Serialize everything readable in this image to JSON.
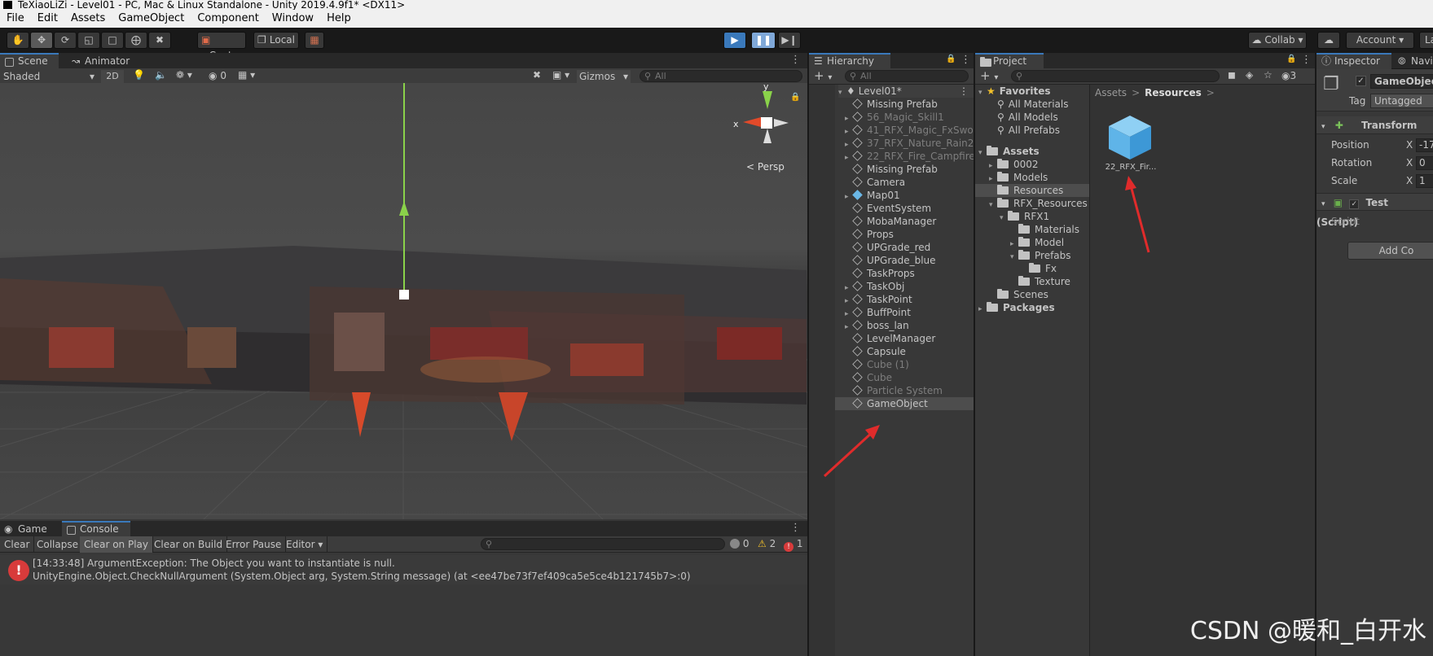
{
  "window": {
    "title": "TeXiaoLiZi - Level01 - PC, Mac & Linux Standalone - Unity 2019.4.9f1* <DX11>"
  },
  "menu": [
    "File",
    "Edit",
    "Assets",
    "GameObject",
    "Component",
    "Window",
    "Help"
  ],
  "toolbar": {
    "center_label": "Center",
    "local_label": "Local",
    "collab_label": "Collab",
    "account_label": "Account",
    "layers_label": "La"
  },
  "scene_panel": {
    "tabs": [
      "Scene",
      "Animator"
    ],
    "shading": "Shaded",
    "mode_2d": "2D",
    "hidden_count": "0",
    "gizmos_label": "Gizmos",
    "search_placeholder": "All",
    "persp_label": "Persp",
    "axis_x": "x",
    "axis_y": "y"
  },
  "hierarchy": {
    "tab": "Hierarchy",
    "search_placeholder": "All",
    "scene_name": "Level01*",
    "items": [
      {
        "label": "Missing Prefab",
        "style": "normal",
        "expand": false
      },
      {
        "label": "56_Magic_Skill1",
        "style": "dim",
        "expand": true
      },
      {
        "label": "41_RFX_Magic_FxSwo",
        "style": "dim",
        "expand": true
      },
      {
        "label": "37_RFX_Nature_Rain2",
        "style": "dim",
        "expand": true
      },
      {
        "label": "22_RFX_Fire_Campfire",
        "style": "dim",
        "expand": true
      },
      {
        "label": "Missing Prefab",
        "style": "normal",
        "expand": false
      },
      {
        "label": "Camera",
        "style": "normal",
        "expand": false
      },
      {
        "label": "Map01",
        "style": "normal",
        "expand": true
      },
      {
        "label": "EventSystem",
        "style": "normal",
        "expand": false
      },
      {
        "label": "MobaManager",
        "style": "normal",
        "expand": false
      },
      {
        "label": "Props",
        "style": "normal",
        "expand": false
      },
      {
        "label": "UPGrade_red",
        "style": "normal",
        "expand": false
      },
      {
        "label": "UPGrade_blue",
        "style": "normal",
        "expand": false
      },
      {
        "label": "TaskProps",
        "style": "normal",
        "expand": false
      },
      {
        "label": "TaskObj",
        "style": "normal",
        "expand": true
      },
      {
        "label": "TaskPoint",
        "style": "normal",
        "expand": true
      },
      {
        "label": "BuffPoint",
        "style": "normal",
        "expand": true
      },
      {
        "label": "boss_lan",
        "style": "normal",
        "expand": true
      },
      {
        "label": "LevelManager",
        "style": "normal",
        "expand": false
      },
      {
        "label": "Capsule",
        "style": "normal",
        "expand": false
      },
      {
        "label": "Cube (1)",
        "style": "dim",
        "expand": false
      },
      {
        "label": "Cube",
        "style": "dim",
        "expand": false
      },
      {
        "label": "Particle System",
        "style": "dim",
        "expand": false
      },
      {
        "label": "GameObject",
        "style": "selected",
        "expand": false
      }
    ]
  },
  "project": {
    "tab": "Project",
    "breadcrumb": [
      "Assets",
      "Resources"
    ],
    "hidden_count": "3",
    "tree": [
      {
        "label": "Favorites",
        "indent": 0,
        "kind": "star",
        "arrow": "open"
      },
      {
        "label": "All Materials",
        "indent": 1,
        "kind": "search",
        "arrow": ""
      },
      {
        "label": "All Models",
        "indent": 1,
        "kind": "search",
        "arrow": ""
      },
      {
        "label": "All Prefabs",
        "indent": 1,
        "kind": "search",
        "arrow": ""
      },
      {
        "label": "",
        "indent": 0,
        "kind": "gap",
        "arrow": ""
      },
      {
        "label": "Assets",
        "indent": 0,
        "kind": "folder",
        "arrow": "open"
      },
      {
        "label": "0002",
        "indent": 1,
        "kind": "folder",
        "arrow": "closed"
      },
      {
        "label": "Models",
        "indent": 1,
        "kind": "folder",
        "arrow": "closed"
      },
      {
        "label": "Resources",
        "indent": 1,
        "kind": "folder",
        "arrow": "",
        "selected": true
      },
      {
        "label": "RFX_Resources",
        "indent": 1,
        "kind": "folder",
        "arrow": "open"
      },
      {
        "label": "RFX1",
        "indent": 2,
        "kind": "folder",
        "arrow": "open"
      },
      {
        "label": "Materials",
        "indent": 3,
        "kind": "folder",
        "arrow": ""
      },
      {
        "label": "Model",
        "indent": 3,
        "kind": "folder",
        "arrow": "closed"
      },
      {
        "label": "Prefabs",
        "indent": 3,
        "kind": "folder",
        "arrow": "open"
      },
      {
        "label": "Fx",
        "indent": 4,
        "kind": "folder",
        "arrow": ""
      },
      {
        "label": "Texture",
        "indent": 3,
        "kind": "folder",
        "arrow": ""
      },
      {
        "label": "Scenes",
        "indent": 1,
        "kind": "folder",
        "arrow": ""
      },
      {
        "label": "Packages",
        "indent": 0,
        "kind": "folder",
        "arrow": "closed"
      }
    ],
    "asset": {
      "label": "22_RFX_Fir..."
    }
  },
  "inspector": {
    "tabs": [
      "Inspector",
      "Navi"
    ],
    "object_name": "GameObject",
    "tag_label": "Tag",
    "tag_value": "Untagged",
    "transform_label": "Transform",
    "fields": [
      {
        "label": "Position",
        "axis": "X",
        "value": "-17"
      },
      {
        "label": "Rotation",
        "axis": "X",
        "value": "0"
      },
      {
        "label": "Scale",
        "axis": "X",
        "value": "1"
      }
    ],
    "script_component": "Test (Script)",
    "script_label": "Script",
    "add_component": "Add Co"
  },
  "console": {
    "tabs": [
      "Game",
      "Console"
    ],
    "buttons": [
      "Clear",
      "Collapse",
      "Clear on Play",
      "Clear on Build",
      "Error Pause",
      "Editor"
    ],
    "counts": {
      "log": "0",
      "warn": "2",
      "error": "1"
    },
    "message": {
      "line1": "[14:33:48] ArgumentException: The Object you want to instantiate is null.",
      "line2": "UnityEngine.Object.CheckNullArgument (System.Object arg, System.String message) (at <ee47be73f7ef409ca5e5ce4b121745b7>:0)"
    }
  },
  "watermark": "CSDN @暖和_白开水",
  "colors": {
    "accent": "#3a79bb",
    "selection": "#4d4d4d",
    "error": "#d83b3b",
    "arrow": "#e02b2b",
    "asset_cube": "#5fb4e8"
  }
}
